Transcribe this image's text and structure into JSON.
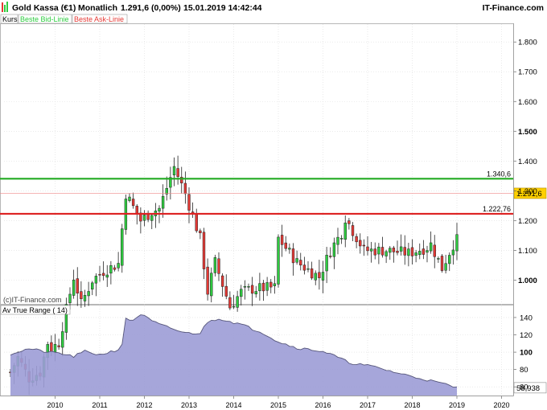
{
  "header": {
    "instrument": "Gold Kassa (€1)",
    "period": "Monatlich",
    "last": "1.291,6 (0,00%)",
    "datetime": "15.01.2019 14:42:44",
    "brand": "IT-Finance.com"
  },
  "legend": {
    "kurs": "Kurs",
    "bid": "Beste Bid-Linie",
    "ask": "Beste Ask-Linie"
  },
  "watermark": "(c)IT-Finance.com",
  "colors": {
    "background": "#ffffff",
    "bull": "#2ecc40",
    "bear": "#e53935",
    "line_green": "#22aa22",
    "line_red": "#dd2222",
    "price_marker": "#ffd000",
    "atr_fill": "#9c9cd6",
    "atr_line": "#55557a"
  },
  "chart_data": [
    {
      "type": "candlestick",
      "title": "Gold Kassa (€1)",
      "interval": "monthly",
      "ylim": [
        920,
        1860
      ],
      "yticks": [
        1000,
        1100,
        1200,
        1300,
        1400,
        1500,
        1600,
        1700,
        1800
      ],
      "ytick_labels": [
        "1.000",
        "1.100",
        "1.200",
        "1.300",
        "1.400",
        "1.500",
        "1.600",
        "1.700",
        "1.800"
      ],
      "xticks": [
        "2010",
        "2011",
        "2012",
        "2013",
        "2014",
        "2015",
        "2016",
        "2017",
        "2018",
        "2019",
        "2020"
      ],
      "xtick_years": [
        2010,
        2011,
        2012,
        2013,
        2014,
        2015,
        2016,
        2017,
        2018,
        2019,
        2020
      ],
      "x_start": "2009-01",
      "hlines": [
        {
          "value": 1340.6,
          "label": "1.340,6",
          "color": "#22aa22"
        },
        {
          "value": 1222.76,
          "label": "1.222,76",
          "color": "#dd2222"
        }
      ],
      "last_price": {
        "value": 1291.6,
        "label": "1.291,6"
      },
      "keypoints": [
        [
          "2009-01",
          690
        ],
        [
          "2009-03",
          740
        ],
        [
          "2009-06",
          670
        ],
        [
          "2009-09",
          690
        ],
        [
          "2009-11",
          790
        ],
        [
          "2009-12",
          770
        ],
        [
          "2010-02",
          790
        ],
        [
          "2010-06",
          1010
        ],
        [
          "2010-08",
          920
        ],
        [
          "2010-11",
          1000
        ],
        [
          "2011-02",
          1030
        ],
        [
          "2011-06",
          1055
        ],
        [
          "2011-08",
          1290
        ],
        [
          "2011-12",
          1200
        ],
        [
          "2012-03",
          1230
        ],
        [
          "2012-05",
          1240
        ],
        [
          "2012-09",
          1380
        ],
        [
          "2012-12",
          1290
        ],
        [
          "2013-04",
          1140
        ],
        [
          "2013-06",
          960
        ],
        [
          "2013-08",
          1060
        ],
        [
          "2013-12",
          910
        ],
        [
          "2014-03",
          960
        ],
        [
          "2014-06",
          970
        ],
        [
          "2014-12",
          975
        ],
        [
          "2015-01",
          1140
        ],
        [
          "2015-06",
          1060
        ],
        [
          "2015-12",
          1010
        ],
        [
          "2016-03",
          1100
        ],
        [
          "2016-06",
          1160
        ],
        [
          "2016-07",
          1210
        ],
        [
          "2016-12",
          1100
        ],
        [
          "2017-06",
          1100
        ],
        [
          "2017-12",
          1090
        ],
        [
          "2018-05",
          1110
        ],
        [
          "2018-06",
          1120
        ],
        [
          "2018-09",
          1040
        ],
        [
          "2018-12",
          1120
        ],
        [
          "2019-01",
          1135
        ]
      ]
    },
    {
      "type": "area",
      "title": "Av True Range ( 14)",
      "ylim": [
        50,
        152
      ],
      "yticks": [
        60,
        80,
        100,
        120,
        140
      ],
      "ytick_labels": [
        "60",
        "80",
        "100",
        "120",
        "140"
      ],
      "last_value": {
        "value": 58.938,
        "label": "58,938"
      },
      "keypoints": [
        [
          "2009-01",
          98
        ],
        [
          "2009-06",
          104
        ],
        [
          "2009-11",
          100
        ],
        [
          "2010-02",
          99
        ],
        [
          "2010-06",
          95
        ],
        [
          "2010-09",
          101
        ],
        [
          "2011-01",
          97
        ],
        [
          "2011-06",
          103
        ],
        [
          "2011-07",
          110
        ],
        [
          "2011-08",
          138
        ],
        [
          "2011-10",
          137
        ],
        [
          "2011-12",
          144
        ],
        [
          "2012-03",
          136
        ],
        [
          "2012-05",
          132
        ],
        [
          "2012-12",
          122
        ],
        [
          "2013-04",
          122
        ],
        [
          "2013-06",
          135
        ],
        [
          "2013-09",
          139
        ],
        [
          "2014-03",
          132
        ],
        [
          "2014-09",
          122
        ],
        [
          "2015-01",
          112
        ],
        [
          "2015-06",
          105
        ],
        [
          "2016-01",
          101
        ],
        [
          "2016-04",
          96
        ],
        [
          "2016-08",
          88
        ],
        [
          "2017-03",
          83
        ],
        [
          "2017-09",
          76
        ],
        [
          "2018-03",
          70
        ],
        [
          "2018-09",
          64
        ],
        [
          "2019-01",
          59
        ]
      ]
    }
  ]
}
